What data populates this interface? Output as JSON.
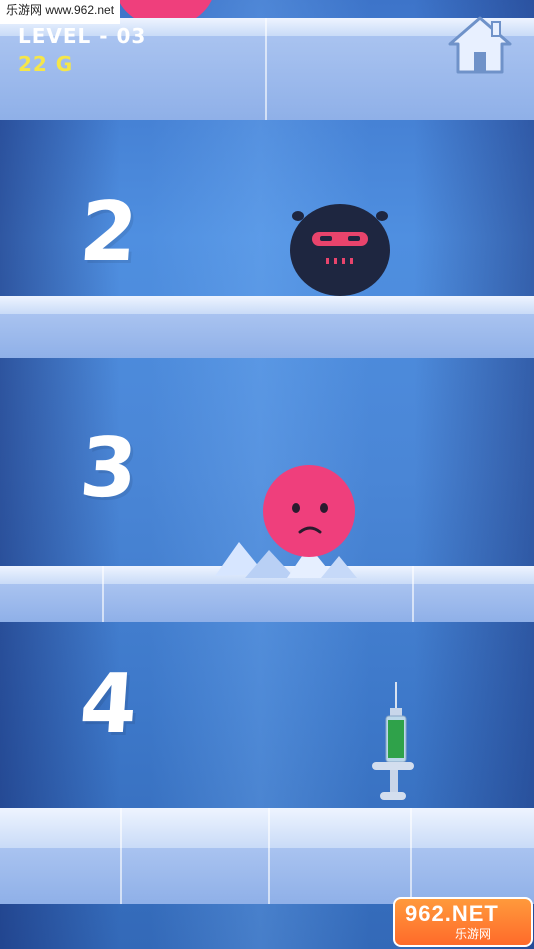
{
  "hud": {
    "level_label": "LEVEL - 03",
    "gold_label": "22 G"
  },
  "floors": [
    {
      "number": "2"
    },
    {
      "number": "3"
    },
    {
      "number": "4"
    }
  ],
  "watermark_top": "乐游网 www.962.net",
  "watermark_logo": {
    "main": "962.NET",
    "sub": "乐游网"
  },
  "icons": {
    "home": "home-icon",
    "enemy": "dark-spiky-blob",
    "player": "pink-ball-character",
    "item": "syringe-green"
  },
  "colors": {
    "gold_text": "#f5e64a",
    "player_ball": "#ef3f7c",
    "enemy_blob": "#1e2640",
    "syringe_liquid": "#2fa24a"
  }
}
